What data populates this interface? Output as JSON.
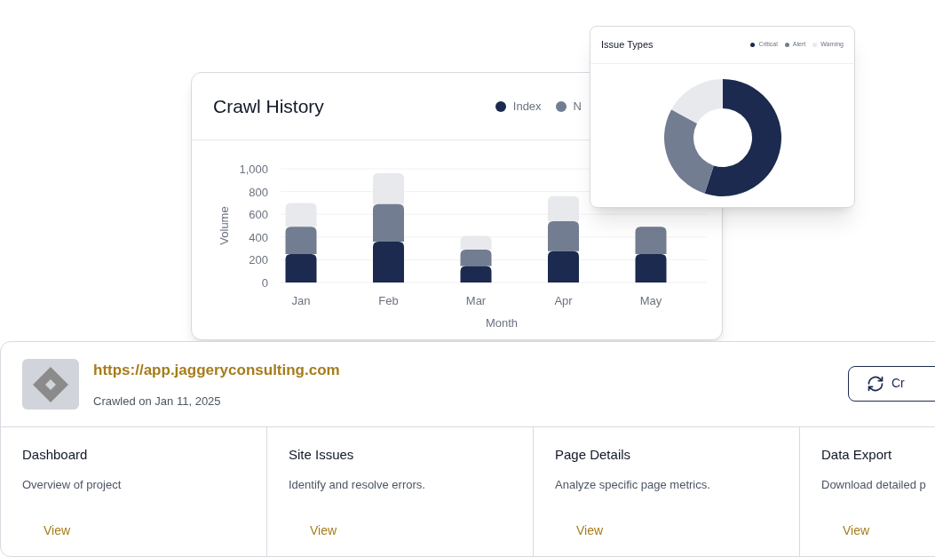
{
  "crawl_history": {
    "title": "Crawl History",
    "chart_data": {
      "type": "bar",
      "stacked": true,
      "grid": true,
      "xlabel": "Month",
      "ylabel": "Volume",
      "categories": [
        "Jan",
        "Feb",
        "Mar",
        "Apr",
        "May"
      ],
      "ylim": [
        0,
        1000
      ],
      "yticks": [
        0,
        200,
        400,
        600,
        800,
        {
          "value": 1000,
          "label": "1,000"
        }
      ],
      "series": [
        {
          "name": "Index",
          "color": "#1b2a4e",
          "values": [
            250,
            360,
            145,
            275,
            250
          ]
        },
        {
          "name": "N",
          "color": "#737d91",
          "values": [
            240,
            330,
            145,
            265,
            240
          ]
        },
        {
          "color": "#e8e9ed",
          "values": [
            210,
            270,
            120,
            220,
            null
          ]
        }
      ]
    }
  },
  "issue_types": {
    "title": "Issue Types",
    "chart_data": {
      "type": "donut",
      "categories": [
        "Critical",
        "Alert",
        "Warning"
      ],
      "series": [
        {
          "colors": [
            "#1b2a4e",
            "#737d91",
            "#e8e9ed"
          ],
          "values": [
            55,
            28,
            17
          ]
        }
      ]
    }
  },
  "project": {
    "url": "https://app.jaggeryconsulting.com",
    "crawled": "Crawled on Jan 11, 2025",
    "button": "Cr"
  },
  "sections": [
    {
      "title": "Dashboard",
      "description": "Overview of project",
      "link": "View"
    },
    {
      "title": "Site Issues",
      "description": "Identify and resolve errors.",
      "link": "View"
    },
    {
      "title": "Page Details",
      "description": "Analyze specific page metrics.",
      "link": "View"
    },
    {
      "title": "Data Export",
      "description": "Download detailed p",
      "link": "View"
    }
  ]
}
